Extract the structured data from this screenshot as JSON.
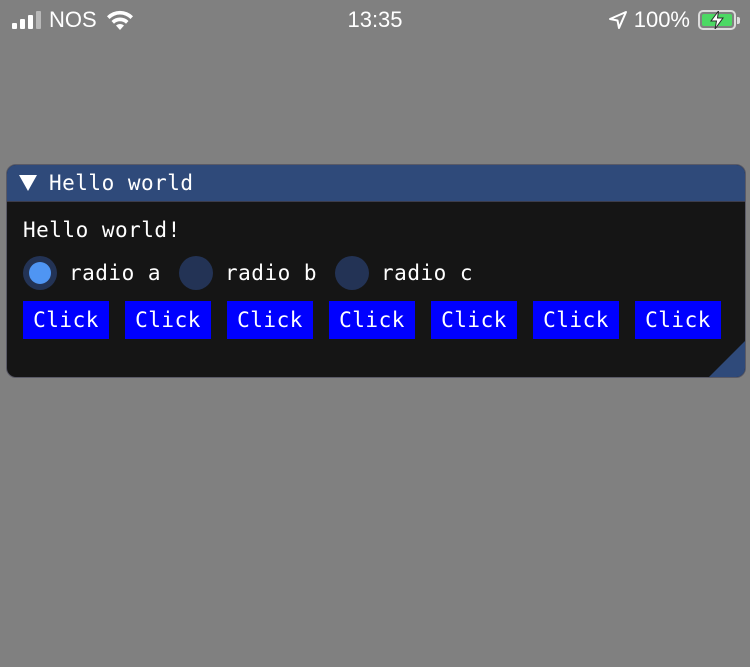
{
  "status_bar": {
    "carrier": "NOS",
    "time": "13:35",
    "battery_percent": "100%",
    "battery_level": 1.0,
    "icons": {
      "signal": "signal-bars-icon",
      "wifi": "wifi-icon",
      "location": "location-arrow-icon",
      "battery": "battery-charging-icon"
    }
  },
  "window": {
    "title": "Hello world",
    "collapse_icon": "triangle-down-icon",
    "text": "Hello world!",
    "radios": [
      {
        "label": "radio a",
        "selected": true
      },
      {
        "label": "radio b",
        "selected": false
      },
      {
        "label": "radio c",
        "selected": false
      }
    ],
    "buttons": [
      {
        "label": "Click"
      },
      {
        "label": "Click"
      },
      {
        "label": "Click"
      },
      {
        "label": "Click"
      },
      {
        "label": "Click"
      },
      {
        "label": "Click"
      },
      {
        "label": "Click"
      }
    ],
    "resize_icon": "resize-grip-icon"
  },
  "colors": {
    "background": "#808080",
    "window_bg": "#151515",
    "titlebar": "#2f4a7a",
    "button": "#0000ff",
    "radio_bg": "#233355",
    "radio_checked": "#4f95f3",
    "battery_fill": "#4cd964"
  }
}
